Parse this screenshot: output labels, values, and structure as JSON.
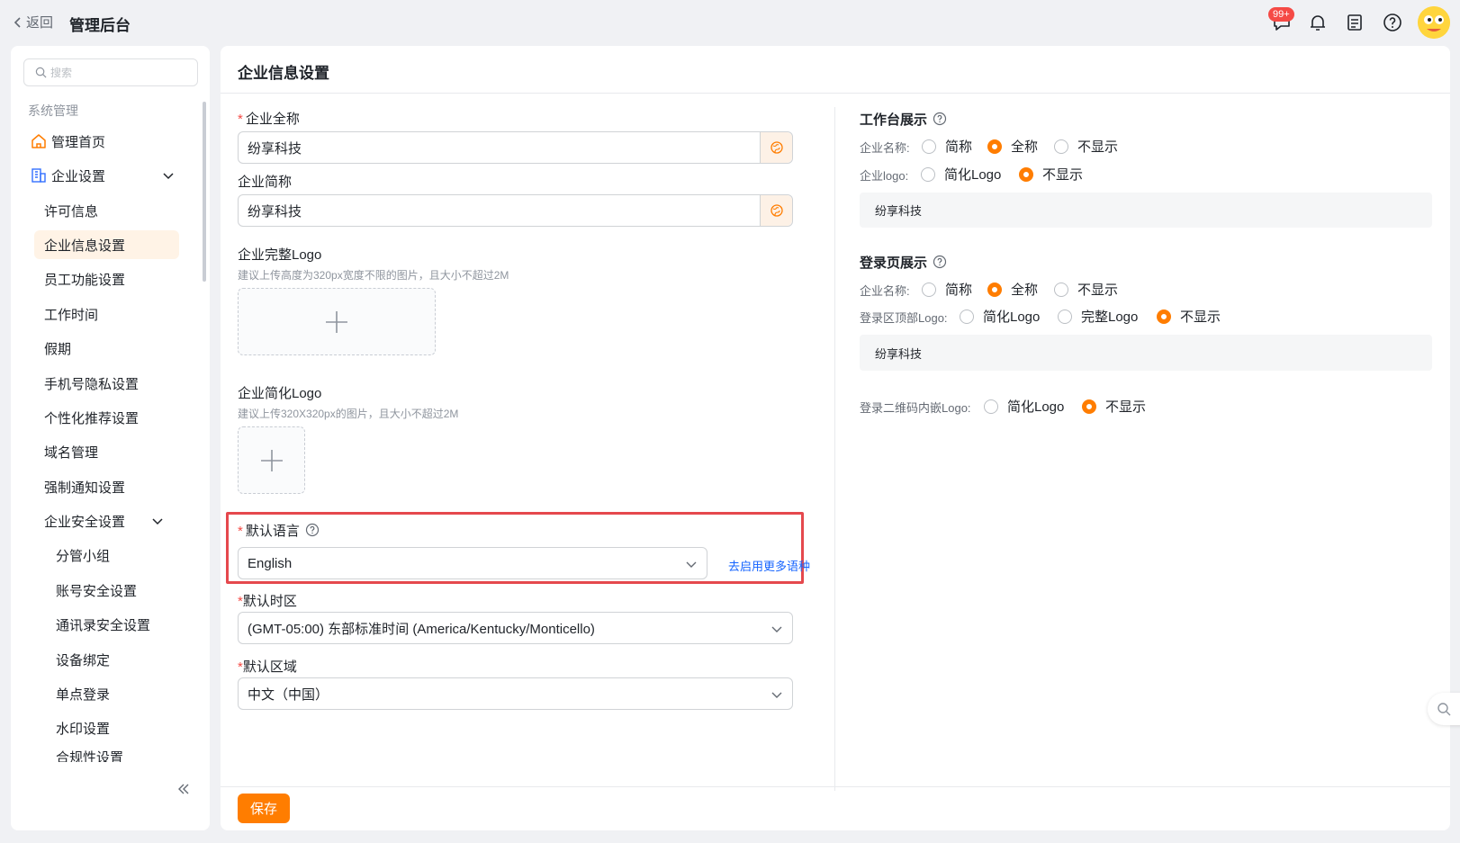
{
  "header": {
    "back_label": "返回",
    "title": "管理后台",
    "notification_badge": "99+"
  },
  "sidebar": {
    "search_placeholder": "搜索",
    "group_label": "系统管理",
    "items": [
      {
        "label": "管理首页"
      },
      {
        "label": "企业设置"
      },
      {
        "label": "许可信息"
      },
      {
        "label": "企业信息设置"
      },
      {
        "label": "员工功能设置"
      },
      {
        "label": "工作时间"
      },
      {
        "label": "假期"
      },
      {
        "label": "手机号隐私设置"
      },
      {
        "label": "个性化推荐设置"
      },
      {
        "label": "域名管理"
      },
      {
        "label": "强制通知设置"
      },
      {
        "label": "企业安全设置"
      },
      {
        "label": "分管小组"
      },
      {
        "label": "账号安全设置"
      },
      {
        "label": "通讯录安全设置"
      },
      {
        "label": "设备绑定"
      },
      {
        "label": "单点登录"
      },
      {
        "label": "水印设置"
      },
      {
        "label": "合规性设置"
      }
    ]
  },
  "main": {
    "page_title": "企业信息设置",
    "full_name_label": "企业全称",
    "full_name_value": "纷享科技",
    "short_name_label": "企业简称",
    "short_name_value": "纷享科技",
    "full_logo_label": "企业完整Logo",
    "full_logo_hint": "建议上传高度为320px宽度不限的图片，且大小不超过2M",
    "short_logo_label": "企业简化Logo",
    "short_logo_hint": "建议上传320X320px的图片，且大小不超过2M",
    "language_label": "默认语言",
    "language_value": "English",
    "language_link": "去启用更多语种",
    "timezone_label": "默认时区",
    "timezone_value": "(GMT-05:00) 东部标准时间 (America/Kentucky/Monticello)",
    "region_label": "默认区域",
    "region_value": "中文（中国）",
    "save_label": "保存"
  },
  "workbench": {
    "title": "工作台展示",
    "name_label": "企业名称:",
    "name_options": [
      "简称",
      "全称",
      "不显示"
    ],
    "name_selected": "全称",
    "logo_label": "企业logo:",
    "logo_options": [
      "简化Logo",
      "不显示"
    ],
    "logo_selected": "不显示",
    "preview_text": "纷享科技"
  },
  "login": {
    "title": "登录页展示",
    "name_label": "企业名称:",
    "name_options": [
      "简称",
      "全称",
      "不显示"
    ],
    "name_selected": "全称",
    "top_logo_label": "登录区顶部Logo:",
    "top_logo_options": [
      "简化Logo",
      "完整Logo",
      "不显示"
    ],
    "top_logo_selected": "不显示",
    "preview_text": "纷享科技",
    "qr_logo_label": "登录二维码内嵌Logo:",
    "qr_logo_options": [
      "简化Logo",
      "不显示"
    ],
    "qr_logo_selected": "不显示"
  },
  "colors": {
    "accent": "#ff7d00",
    "link": "#1664ff",
    "highlight": "#e5484d"
  }
}
